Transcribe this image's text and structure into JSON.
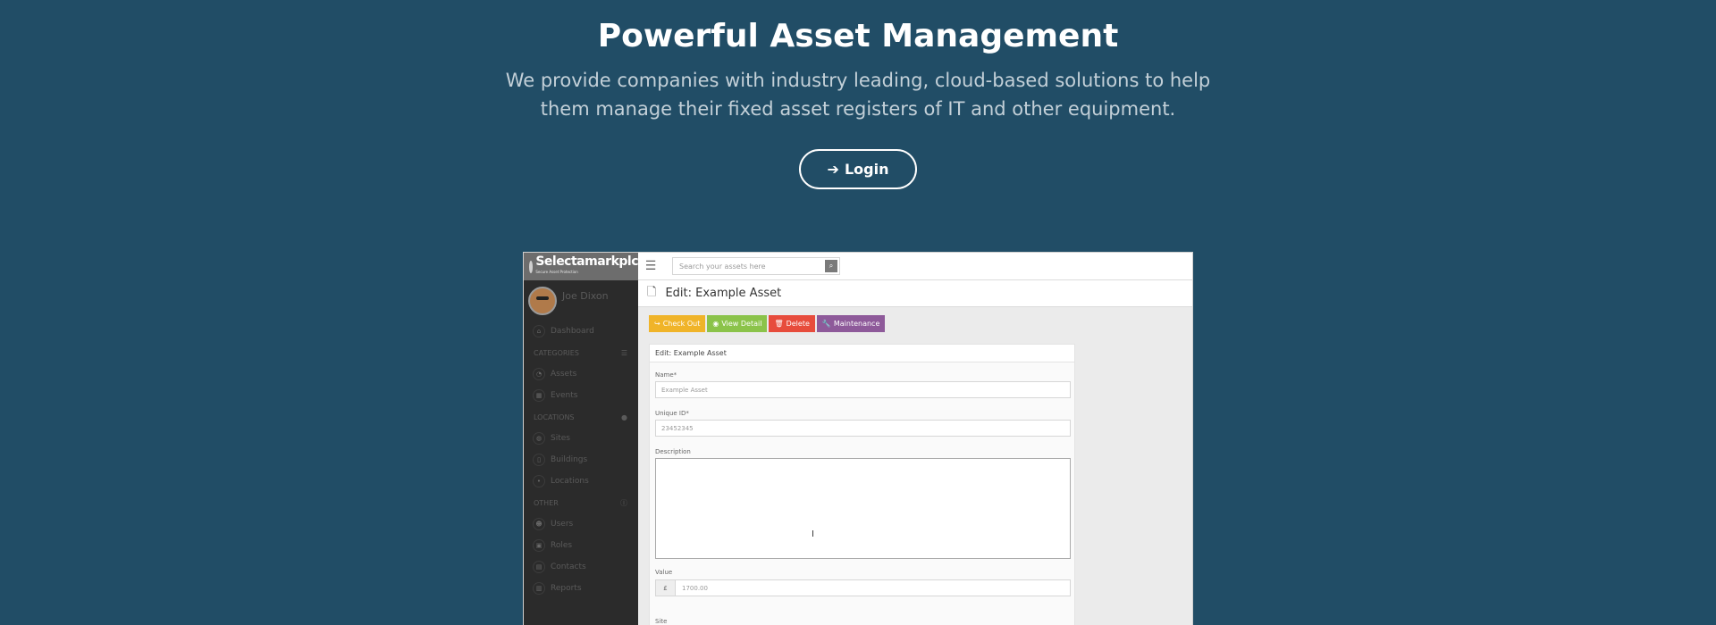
{
  "hero": {
    "title": "Powerful Asset Management",
    "subtitle": "We provide companies with industry leading, cloud-based solutions to help them manage their fixed asset registers of IT and other equipment.",
    "login_label": "Login"
  },
  "app": {
    "brand": "Selectamarkplc",
    "brand_tag": "Secure Asset Protection",
    "user_name": "Joe Dixon",
    "search_placeholder": "Search your assets here",
    "page_title": "Edit: Example Asset",
    "nav": {
      "dashboard": "Dashboard",
      "categories_head": "Categories",
      "assets": "Assets",
      "events": "Events",
      "locations_head": "Locations",
      "sites": "Sites",
      "buildings": "Buildings",
      "locations": "Locations",
      "other_head": "Other",
      "users": "Users",
      "roles": "Roles",
      "contacts": "Contacts",
      "reports": "Reports"
    },
    "actions": {
      "check_out": "Check Out",
      "view_detail": "View Detail",
      "delete": "Delete",
      "maintenance": "Maintenance"
    },
    "form": {
      "panel_title": "Edit: Example Asset",
      "name_label": "Name*",
      "name_value": "Example Asset",
      "uid_label": "Unique ID*",
      "uid_value": "23452345",
      "description_label": "Description",
      "value_label": "Value",
      "currency": "£",
      "value_value": "1700.00",
      "site_label": "Site"
    }
  }
}
